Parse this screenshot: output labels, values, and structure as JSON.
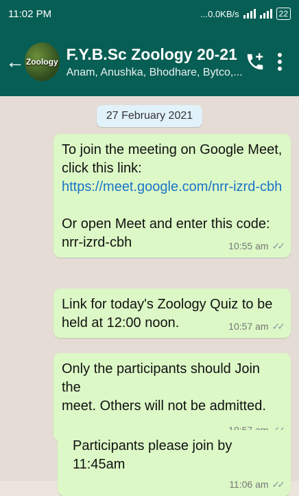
{
  "status": {
    "time": "11:02 PM",
    "network": "...0.0KB/s",
    "battery": "22"
  },
  "header": {
    "avatar_text": "Zoology",
    "title": "F.Y.B.Sc Zoology 20-21",
    "subtitle": "Anam, Anushka, Bhodhare, Bytco,..."
  },
  "date_chip": "27 February 2021",
  "messages": [
    {
      "lines": [
        "To join the meeting on Google Meet,",
        "click this link:"
      ],
      "link": "https://meet.google.com/nrr-izrd-cbh",
      "after": [
        "Or open Meet and enter this code:",
        "nrr-izrd-cbh"
      ],
      "time": "10:55 am",
      "ticks": "✓✓"
    },
    {
      "lines": [
        "Link for today's Zoology Quiz to be",
        "held at 12:00 noon."
      ],
      "time": "10:57 am",
      "ticks": "✓✓"
    },
    {
      "lines": [
        "Only the participants should Join the",
        "meet. Others will not be admitted."
      ],
      "time": "10:57 am",
      "ticks": "✓✓"
    },
    {
      "lines": [
        "Participants please join by 11:45am"
      ],
      "time": "11:06 am",
      "ticks": "✓✓"
    }
  ],
  "colors": {
    "header": "#075e54",
    "bubble": "#dcf8c6",
    "background": "#e5ddd5",
    "link": "#1a73c8"
  }
}
